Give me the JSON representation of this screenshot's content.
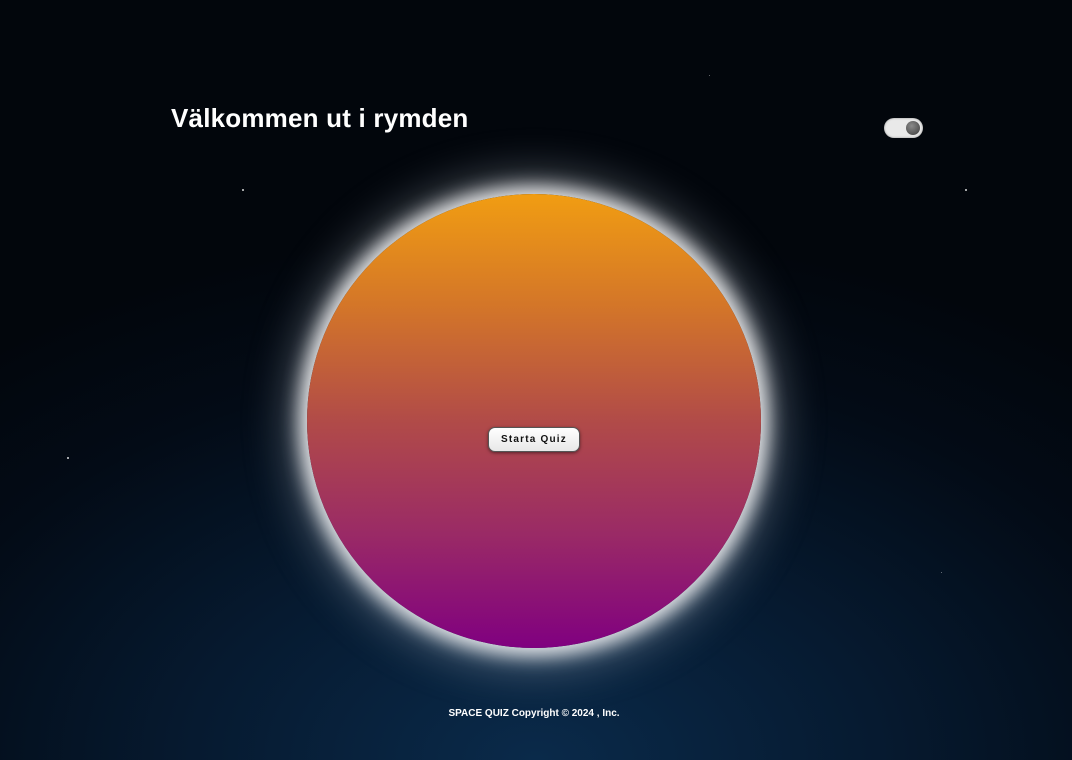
{
  "header": {
    "title": "Välkommen ut i rymden"
  },
  "theme_toggle": {
    "state": "on"
  },
  "planet": {
    "gradient_top": "#f19d12",
    "gradient_bottom": "#800080",
    "glow": "#ffffff"
  },
  "main": {
    "start_label": "Starta Quiz"
  },
  "footer": {
    "copyright": "SPACE QUIZ Copyright © 2024 , Inc."
  },
  "colors": {
    "background_top": "#02060c",
    "background_bottom": "#0a2a4a",
    "text": "#ffffff"
  }
}
